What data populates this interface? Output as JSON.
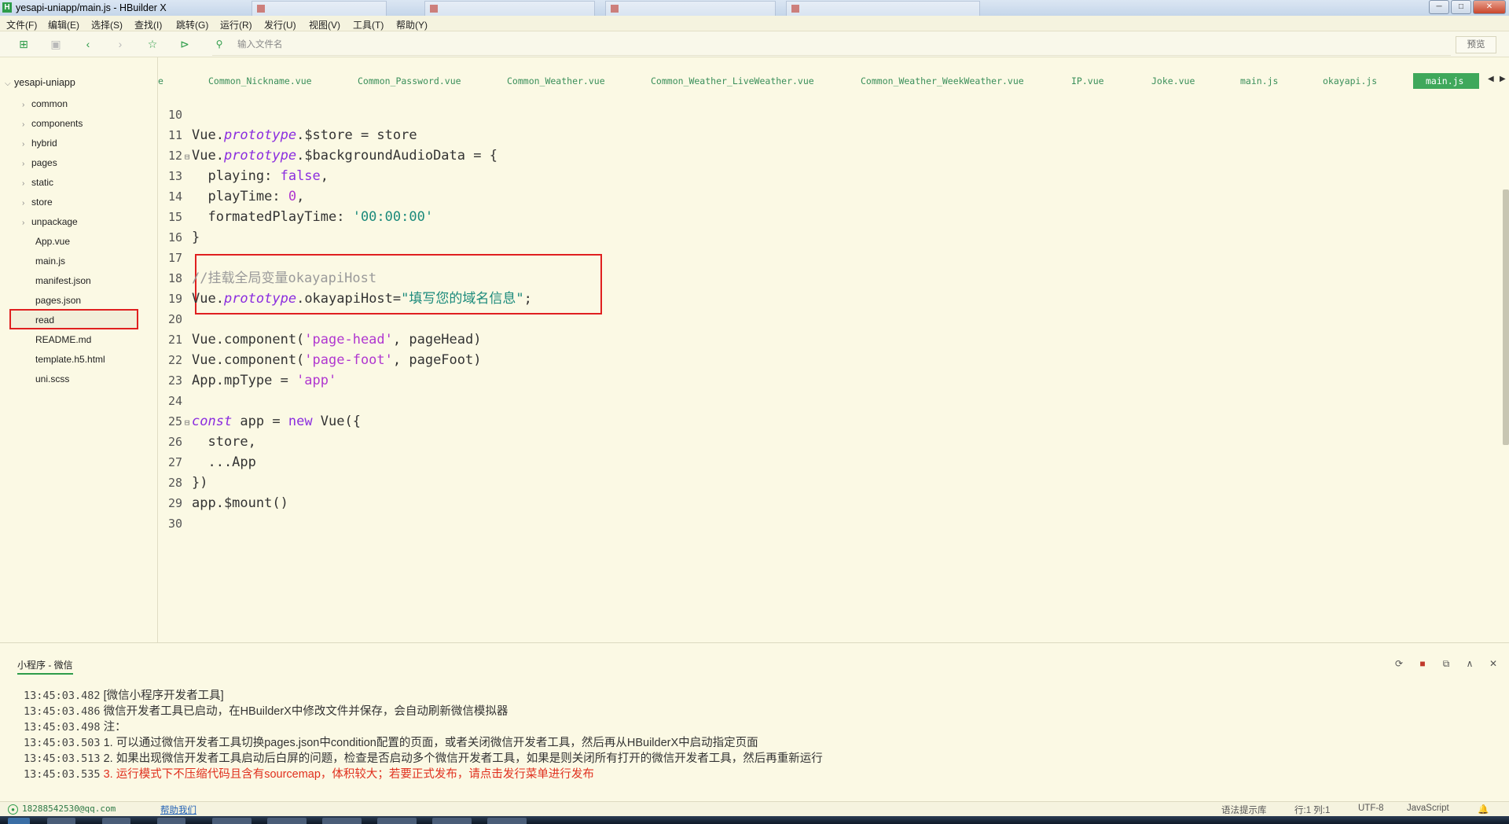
{
  "window": {
    "title": "yesapi-uniapp/main.js - HBuilder X",
    "controls": {
      "minimize": "─",
      "maximize": "□",
      "close": "✕"
    }
  },
  "menu": [
    "文件(F)",
    "编辑(E)",
    "选择(S)",
    "查找(I)",
    "跳转(G)",
    "运行(R)",
    "发行(U)",
    "视图(V)",
    "工具(T)",
    "帮助(Y)"
  ],
  "toolbar": {
    "icons": [
      "new-file-icon",
      "save-icon",
      "back-icon",
      "forward-icon",
      "star-icon",
      "run-icon",
      "search-file-icon"
    ],
    "search_placeholder": "输入文件名",
    "preview_label": "预览"
  },
  "sidebar": {
    "root": "yesapi-uniapp",
    "folders": [
      "common",
      "components",
      "hybrid",
      "pages",
      "static",
      "store",
      "unpackage"
    ],
    "files": [
      "App.vue",
      "main.js",
      "manifest.json",
      "pages.json",
      "read",
      "README.md",
      "template.h5.html",
      "uni.scss"
    ],
    "selected": "main.js"
  },
  "tabs": {
    "items": [
      "e",
      "Common_Nickname.vue",
      "Common_Password.vue",
      "Common_Weather.vue",
      "Common_Weather_LiveWeather.vue",
      "Common_Weather_WeekWeather.vue",
      "IP.vue",
      "Joke.vue",
      "main.js",
      "okayapi.js"
    ],
    "active": "main.js",
    "nav_prev": "◀",
    "nav_next": "▶"
  },
  "editor": {
    "line_numbers": [
      "10",
      "11",
      "12",
      "13",
      "14",
      "15",
      "16",
      "17",
      "18",
      "19",
      "20",
      "21",
      "22",
      "23",
      "24",
      "25",
      "26",
      "27",
      "28",
      "29",
      "30"
    ],
    "lines": {
      "l11": [
        "Vue.",
        "prototype",
        ".$store = store"
      ],
      "l12": [
        "Vue.",
        "prototype",
        ".$backgroundAudioData = {"
      ],
      "l13": [
        "  playing: ",
        "false",
        ","
      ],
      "l14": [
        "  playTime: ",
        "0",
        ","
      ],
      "l15": [
        "  formatedPlayTime: ",
        "'00:00:00'"
      ],
      "l16": "}",
      "l18": "//挂载全局变量okayapiHost",
      "l19": [
        "Vue.",
        "prototype",
        ".okayapiHost=",
        "\"填写您的域名信息\"",
        ";"
      ],
      "l21": [
        "Vue.component(",
        "'page-head'",
        ", pageHead)"
      ],
      "l22": [
        "Vue.component(",
        "'page-foot'",
        ", pageFoot)"
      ],
      "l23": [
        "App.mpType = ",
        "'app'"
      ],
      "l25": [
        "const",
        " app = ",
        "new",
        " Vue({"
      ],
      "l26": "  store,",
      "l27": "  ...App",
      "l28": "})",
      "l29": "app.$mount()"
    },
    "fold_marker": "⊟"
  },
  "console": {
    "tab_label": "小程序 - 微信",
    "icons": [
      "rerun-icon",
      "stop-icon",
      "open-external-icon",
      "collapse-icon",
      "close-icon"
    ],
    "logs": [
      {
        "time": "13:45:03.482",
        "text": "[微信小程序开发者工具]"
      },
      {
        "time": "13:45:03.486",
        "text": "微信开发者工具已启动，在HBuilderX中修改文件并保存，会自动刷新微信模拟器"
      },
      {
        "time": "13:45:03.498",
        "text": "注："
      },
      {
        "time": "13:45:03.503",
        "text": "1. 可以通过微信开发者工具切换pages.json中condition配置的页面，或者关闭微信开发者工具，然后再从HBuilderX中启动指定页面"
      },
      {
        "time": "13:45:03.513",
        "text": "2. 如果出现微信开发者工具启动后白屏的问题，检查是否启动多个微信开发者工具，如果是则关闭所有打开的微信开发者工具，然后再重新运行"
      },
      {
        "time": "13:45:03.535",
        "text": "3. 运行模式下不压缩代码且含有sourcemap，体积较大；若要正式发布，请点击发行菜单进行发布"
      }
    ]
  },
  "status": {
    "user": "18288542530@qq.com",
    "help": "帮助我们",
    "hint": "语法提示库",
    "position": "行:1  列:1",
    "encoding": "UTF-8",
    "language": "JavaScript"
  },
  "colors": {
    "accent": "#3fa85b",
    "highlight_border": "#e02020",
    "background": "#fbf9e4",
    "keyword": "#8b2ddf",
    "string": "#1b8a7b"
  }
}
